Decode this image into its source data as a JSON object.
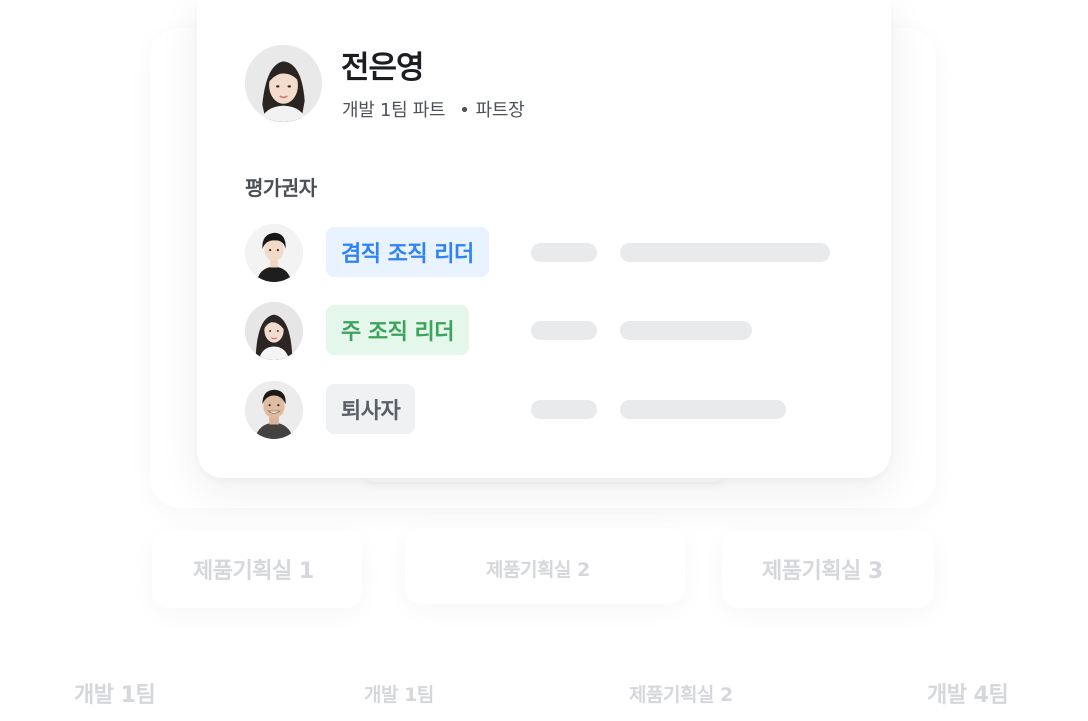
{
  "profile": {
    "name": "전은영",
    "team": "개발 1팀 파트",
    "dot": "•",
    "role": "파트장"
  },
  "evaluators": {
    "title": "평가권자",
    "rows": [
      {
        "badge": "겸직 조직 리더",
        "badge_color": "#3182f6",
        "badge_bg": "#e8f3ff"
      },
      {
        "badge": "주 조직 리더",
        "badge_color": "#3aa45d",
        "badge_bg": "#e5f6ea"
      },
      {
        "badge": "퇴사자",
        "badge_color": "#5b5f66",
        "badge_bg": "#f0f1f3"
      }
    ]
  },
  "background_org": {
    "level1": [
      "제품기획실 1",
      "제품기획실 2",
      "제품기획실 3"
    ],
    "level2": [
      "개발 1팀",
      "개발 1팀",
      "제품기획실 2",
      "개발 4팀"
    ]
  }
}
